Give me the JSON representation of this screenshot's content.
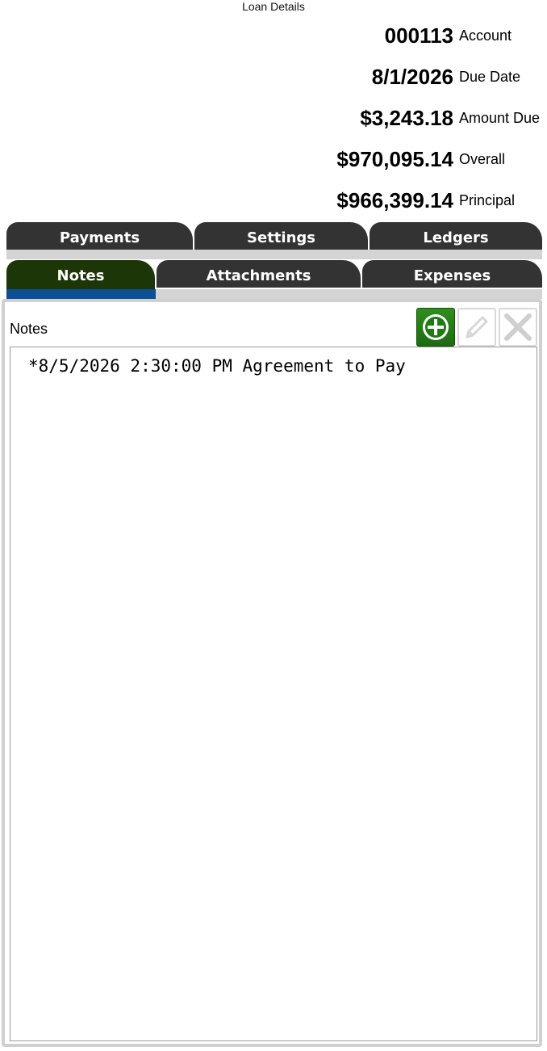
{
  "window": {
    "title": "Loan Details"
  },
  "summary": [
    {
      "value": "000113",
      "label": "Account"
    },
    {
      "value": "8/1/2026",
      "label": "Due Date"
    },
    {
      "value": "$3,243.18",
      "label": "Amount Due"
    },
    {
      "value": "$970,095.14",
      "label": "Overall"
    },
    {
      "value": "$966,399.14",
      "label": "Principal"
    }
  ],
  "tabs_row1": [
    {
      "label": "Payments"
    },
    {
      "label": "Settings"
    },
    {
      "label": "Ledgers"
    }
  ],
  "tabs_row2": [
    {
      "label": "Notes",
      "active": true
    },
    {
      "label": "Attachments",
      "active": false
    },
    {
      "label": "Expenses",
      "active": false
    }
  ],
  "notes_panel": {
    "label": "Notes",
    "buttons": {
      "add_icon": "plus-circle-icon",
      "edit_icon": "pencil-icon",
      "delete_icon": "x-icon"
    },
    "items": [
      {
        "text": "*8/5/2026 2:30:00 PM Agreement to Pay"
      }
    ]
  },
  "colors": {
    "tab_background": "#333333",
    "active_tab_background": "#1c3607",
    "active_indicator": "#0c4f94",
    "add_button": "#2f8e1d"
  }
}
